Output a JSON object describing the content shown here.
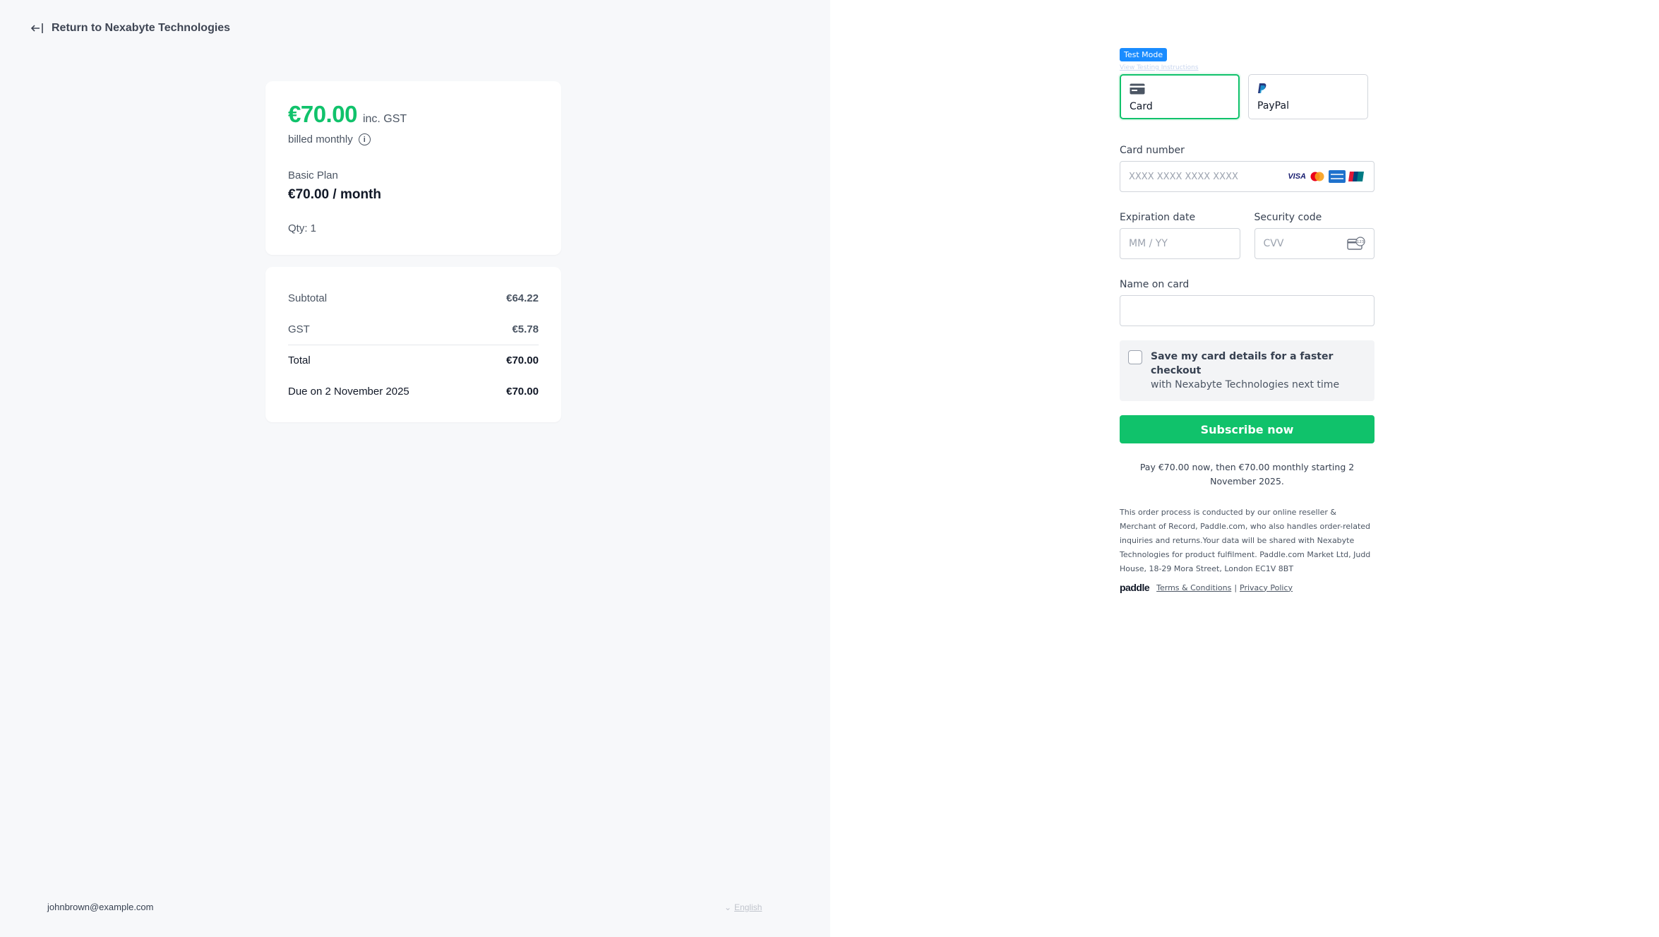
{
  "header": {
    "back_label": "Return to Nexabyte Technologies"
  },
  "summary": {
    "price": "€70.00",
    "price_suffix": "inc. GST",
    "billing": "billed monthly",
    "plan_name": "Basic Plan",
    "plan_price": "€70.00 / month",
    "qty": "Qty: 1"
  },
  "totals": {
    "rows": [
      {
        "label": "Subtotal",
        "value": "€64.22"
      },
      {
        "label": "GST",
        "value": "€5.78"
      },
      {
        "label": "Total",
        "value": "€70.00"
      },
      {
        "label": "Due on 2 November 2025",
        "value": "€70.00"
      }
    ]
  },
  "footer_left": {
    "email": "johnbrown@example.com",
    "language": "English"
  },
  "checkout": {
    "test_badge": "Test Mode",
    "test_link": "View Testing Instructions",
    "methods": [
      {
        "label": "Card"
      },
      {
        "label": "PayPal"
      }
    ],
    "card_number_label": "Card number",
    "card_number_placeholder": "XXXX XXXX XXXX XXXX",
    "brands": [
      "VISA",
      "mastercard",
      "amex",
      "unionpay"
    ],
    "expiry_label": "Expiration date",
    "expiry_placeholder": "MM / YY",
    "cvv_label": "Security code",
    "cvv_placeholder": "CVV",
    "name_label": "Name on card",
    "name_value": "",
    "save_bold": "Save my card details for a faster checkout",
    "save_rest": "with Nexabyte Technologies next time",
    "subscribe_label": "Subscribe now",
    "pay_note": "Pay €70.00 now, then €70.00 monthly starting 2 November 2025.",
    "legal": "This order process is conducted by our online reseller & Merchant of Record, Paddle.com, who also handles order-related inquiries and returns.Your data will be shared with Nexabyte Technologies for product fulfilment. Paddle.com Market Ltd, Judd House, 18-29 Mora Street, London EC1V 8BT",
    "paddle_logo": "paddle",
    "terms_label": "Terms & Conditions",
    "separator": "|",
    "privacy_label": "Privacy Policy"
  },
  "colors": {
    "accent": "#10c26b",
    "test_badge": "#1a8cff",
    "left_bg": "#f7f8fa"
  }
}
